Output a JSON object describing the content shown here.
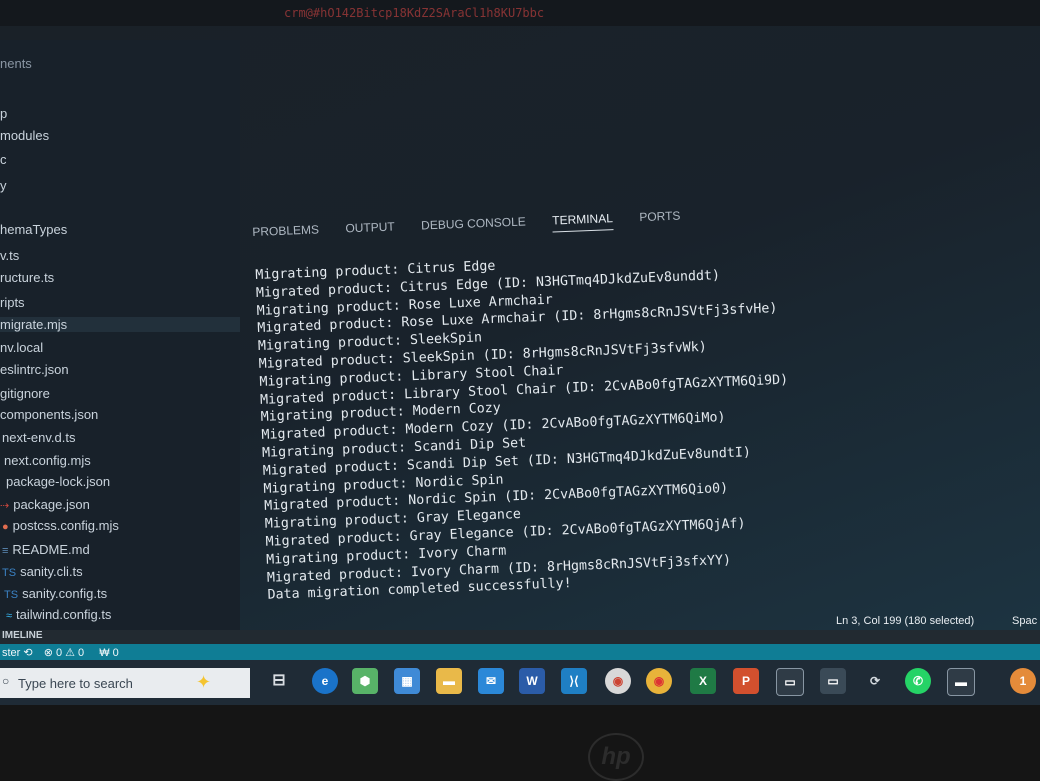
{
  "window": {
    "top_text": "crm@#hO142Bitcp18KdZ2SAraCl1h8KU7bbc"
  },
  "sidebar": {
    "items": [
      {
        "label": "nents",
        "icon": ""
      },
      {
        "label": "p",
        "icon": ""
      },
      {
        "label": "modules",
        "icon": ""
      },
      {
        "label": "c",
        "icon": ""
      },
      {
        "label": "y",
        "icon": ""
      },
      {
        "label": "hemaTypes",
        "icon": ""
      },
      {
        "label": "v.ts",
        "icon": ""
      },
      {
        "label": "ructure.ts",
        "icon": ""
      },
      {
        "label": "ripts",
        "icon": ""
      },
      {
        "label": "migrate.mjs",
        "icon": ""
      },
      {
        "label": "nv.local",
        "icon": ""
      },
      {
        "label": "eslintrc.json",
        "icon": ""
      },
      {
        "label": "gitignore",
        "icon": ""
      },
      {
        "label": "components.json",
        "icon": ""
      },
      {
        "label": "next-env.d.ts",
        "icon": ""
      },
      {
        "label": "next.config.mjs",
        "icon": ""
      },
      {
        "label": "package-lock.json",
        "icon": ""
      },
      {
        "label": "package.json",
        "icon": "⇢"
      },
      {
        "label": "postcss.config.mjs",
        "icon": "●"
      },
      {
        "label": "README.md",
        "icon": "≡"
      },
      {
        "label": "sanity.cli.ts",
        "icon": "TS"
      },
      {
        "label": "sanity.config.ts",
        "icon": "TS"
      },
      {
        "label": "tailwind.config.ts",
        "icon": "≈"
      }
    ]
  },
  "panel": {
    "tabs": [
      "PROBLEMS",
      "OUTPUT",
      "DEBUG CONSOLE",
      "TERMINAL",
      "PORTS"
    ],
    "active_tab": "TERMINAL"
  },
  "terminal": {
    "lines": [
      "Migrating product: Citrus Edge",
      "Migrated product: Citrus Edge (ID: N3HGTmq4DJkdZuEv8unddt)",
      "Migrating product: Rose Luxe Armchair",
      "Migrated product: Rose Luxe Armchair (ID: 8rHgms8cRnJSVtFj3sfvHe)",
      "Migrating product: SleekSpin",
      "Migrated product: SleekSpin (ID: 8rHgms8cRnJSVtFj3sfvWk)",
      "Migrating product: Library Stool Chair",
      "Migrated product: Library Stool Chair (ID: 2CvABo0fgTAGzXYTM6Qi9D)",
      "Migrating product: Modern Cozy",
      "Migrated product: Modern Cozy (ID: 2CvABo0fgTAGzXYTM6QiMo)",
      "Migrating product: Scandi Dip Set",
      "Migrated product: Scandi Dip Set (ID: N3HGTmq4DJkdZuEv8undtI)",
      "Migrating product: Nordic Spin",
      "Migrated product: Nordic Spin (ID: 2CvABo0fgTAGzXYTM6Qio0)",
      "Migrating product: Gray Elegance",
      "Migrated product: Gray Elegance (ID: 2CvABo0fgTAGzXYTM6QjAf)",
      "Migrating product: Ivory Charm",
      "Migrated product: Ivory Charm (ID: 8rHgms8cRnJSVtFj3sfxYY)",
      "Data migration completed successfully!"
    ]
  },
  "statusbar": {
    "timeline": "IMELINE",
    "branch": "ster ⟲",
    "problems": "⊗ 0 ⚠ 0",
    "ports": "₩ 0",
    "cursor": "Ln 3, Col 199 (180 selected)",
    "spaces": "Spac"
  },
  "taskbar": {
    "search_placeholder": "Type here to search",
    "apps": [
      "task-view",
      "edge",
      "app",
      "store",
      "file-explorer",
      "mail",
      "word",
      "vscode",
      "chrome-profile",
      "chrome",
      "excel",
      "powerpoint",
      "terminal",
      "app2",
      "app3",
      "whatsapp",
      "console"
    ]
  },
  "colors": {
    "statusbar": "#0f7d95",
    "terminal_text": "#e3e9ee",
    "taskbar": "#1f2b36"
  }
}
